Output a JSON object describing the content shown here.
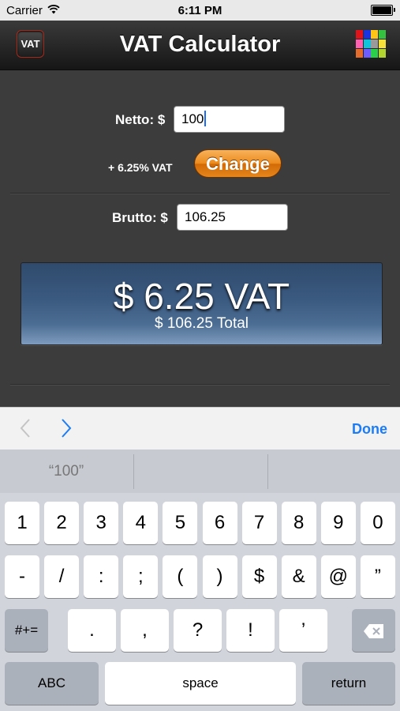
{
  "status_bar": {
    "carrier": "Carrier",
    "time": "6:11 PM"
  },
  "nav": {
    "title": "VAT Calculator",
    "app_icon_label": "VAT",
    "palette_colors": [
      "#e0121a",
      "#1a33e0",
      "#ffc416",
      "#35c240",
      "#ff60b0",
      "#0fc5de",
      "#9a9a9a",
      "#f5e13a",
      "#e46c2c",
      "#6e5cff",
      "#2ad04a",
      "#b3d52f"
    ]
  },
  "form": {
    "netto_label": "Netto: $",
    "netto_value": "100",
    "vat_rate_label": "+ 6.25% VAT",
    "change_button": "Change",
    "brutto_label": "Brutto: $",
    "brutto_value": "106.25"
  },
  "result": {
    "vat_amount": "$ 6.25 VAT",
    "total": "$ 106.25 Total"
  },
  "accessory": {
    "prev_icon": "chevron-left-icon",
    "next_icon": "chevron-right-icon",
    "done": "Done"
  },
  "keyboard": {
    "suggestions": [
      "“100”",
      "",
      ""
    ],
    "row1": [
      "1",
      "2",
      "3",
      "4",
      "5",
      "6",
      "7",
      "8",
      "9",
      "0"
    ],
    "row2": [
      "-",
      "/",
      ":",
      ";",
      "(",
      ")",
      "$",
      "&",
      "@",
      "”"
    ],
    "row3_mode": "#+=",
    "row3": [
      ".",
      ",",
      "?",
      "!",
      "’"
    ],
    "backspace_icon": "backspace-icon",
    "abc": "ABC",
    "space": "space",
    "return": "return"
  },
  "colors": {
    "accent": "#1b7cf5",
    "change_button": "#ec8b1d",
    "result_box": "#3b5a80"
  }
}
